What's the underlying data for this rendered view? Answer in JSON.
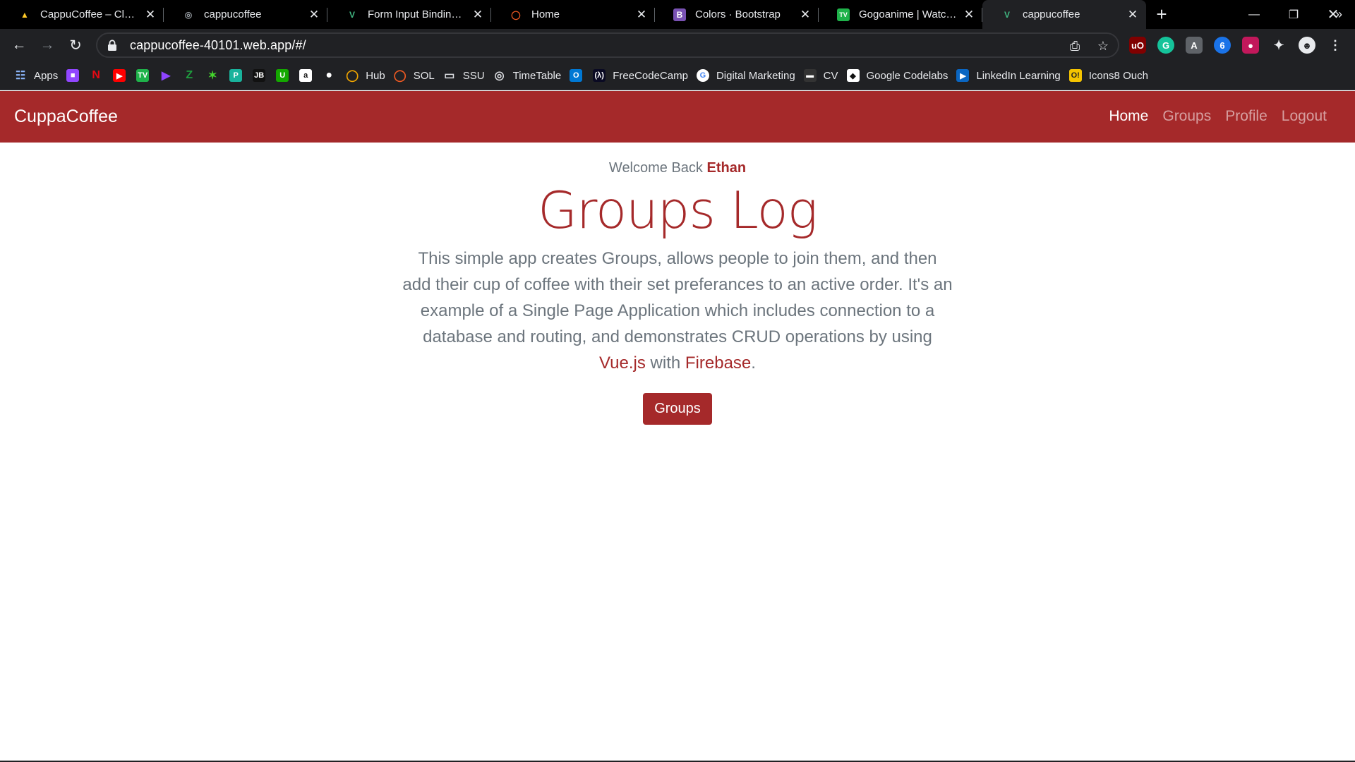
{
  "browser": {
    "tabs": [
      {
        "title": "CappuCoffee – Cloud F",
        "icon": "firebase-icon",
        "color": "#ffca28",
        "active": false
      },
      {
        "title": "cappucoffee",
        "icon": "globe-icon",
        "color": "#9aa0a6",
        "active": false
      },
      {
        "title": "Form Input Bindings —",
        "icon": "vue-icon",
        "color": "#41b883",
        "active": false
      },
      {
        "title": "Home",
        "icon": "origin-ring-icon",
        "color": "#f05a22",
        "active": false
      },
      {
        "title": "Colors · Bootstrap",
        "icon": "bootstrap-icon",
        "color": "#7952b3",
        "active": false
      },
      {
        "title": "Gogoanime | Watch an",
        "icon": "gogoanime-icon",
        "color": "#1fb24a",
        "active": false
      },
      {
        "title": "cappucoffee",
        "icon": "vue-icon",
        "color": "#41b883",
        "active": true
      }
    ],
    "url": "cappucoffee-40101.web.app/#/",
    "bookmarks": [
      {
        "label": "Apps",
        "icon": "apps-grid-icon",
        "color": "#8ab4f8"
      },
      {
        "label": "",
        "icon": "twitch-icon",
        "color": "#9146ff"
      },
      {
        "label": "",
        "icon": "netflix-icon",
        "color": "#e50914"
      },
      {
        "label": "",
        "icon": "youtube-icon",
        "color": "#ff0000"
      },
      {
        "label": "",
        "icon": "tv-icon",
        "color": "#1fb24a"
      },
      {
        "label": "",
        "icon": "play-icon",
        "color": "#8e44ff"
      },
      {
        "label": "",
        "icon": "zedge-icon",
        "color": "#1e9e3e"
      },
      {
        "label": "",
        "icon": "razer-icon",
        "color": "#44d62c"
      },
      {
        "label": "",
        "icon": "paste-icon",
        "color": "#19b39c"
      },
      {
        "label": "",
        "icon": "jetbrains-icon",
        "color": "#111111"
      },
      {
        "label": "",
        "icon": "upwork-icon",
        "color": "#14a800"
      },
      {
        "label": "",
        "icon": "amazon-icon",
        "color": "#ffffff"
      },
      {
        "label": "",
        "icon": "github-icon",
        "color": "#ffffff"
      },
      {
        "label": "Hub",
        "icon": "ring-icon",
        "color": "#f0a500"
      },
      {
        "label": "SOL",
        "icon": "ring-icon",
        "color": "#f05a22"
      },
      {
        "label": "SSU",
        "icon": "page-icon",
        "color": "#dadce0"
      },
      {
        "label": "TimeTable",
        "icon": "globe-icon",
        "color": "#dadce0"
      },
      {
        "label": "",
        "icon": "outlook-icon",
        "color": "#0078d4"
      },
      {
        "label": "FreeCodeCamp",
        "icon": "freecodecamp-icon",
        "color": "#0a0a23"
      },
      {
        "label": "Digital Marketing",
        "icon": "google-icon",
        "color": "#ffffff"
      },
      {
        "label": "CV",
        "icon": "cv-icon",
        "color": "#333333"
      },
      {
        "label": "Google Codelabs",
        "icon": "codelabs-icon",
        "color": "#ffffff"
      },
      {
        "label": "LinkedIn Learning",
        "icon": "linkedin-learning-icon",
        "color": "#0a66c2"
      },
      {
        "label": "Icons8 Ouch",
        "icon": "icons8-icon",
        "color": "#f5c400"
      }
    ],
    "extensions": [
      {
        "name": "ublock-icon",
        "color": "#800000",
        "text": "uO"
      },
      {
        "name": "grammarly-icon",
        "color": "#15c39a",
        "text": "G"
      },
      {
        "name": "extension-gray-icon",
        "color": "#5f6368",
        "text": "A"
      },
      {
        "name": "tabs-icon",
        "color": "#1a73e8",
        "text": "6"
      },
      {
        "name": "owl-icon",
        "color": "#c2185b",
        "text": "●"
      }
    ],
    "more_bookmarks": "»"
  },
  "app": {
    "brand": "CuppaCoffee",
    "nav": [
      {
        "label": "Home",
        "active": true
      },
      {
        "label": "Groups",
        "active": false
      },
      {
        "label": "Profile",
        "active": false
      },
      {
        "label": "Logout",
        "active": false
      }
    ],
    "welcome_prefix": "Welcome Back",
    "user_name": "Ethan",
    "headline": "Groups Log",
    "lead_text": "This simple app creates Groups, allows people to join them, and then add their cup of coffee with their set preferances to an active order. It's an example of a Single Page Application which includes connection to a database and routing, and demonstrates CRUD operations by using",
    "link_vue": "Vue.js",
    "lead_with": "with",
    "link_firebase": "Firebase",
    "lead_end": ".",
    "cta_label": "Groups",
    "colors": {
      "brand": "#a5292a",
      "muted": "#6c757d"
    }
  }
}
